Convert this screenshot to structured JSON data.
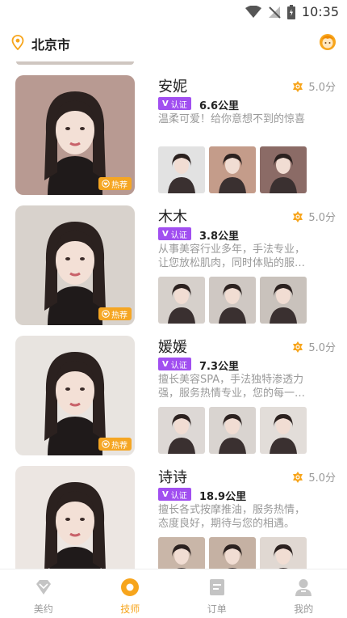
{
  "status_bar": {
    "time": "10:35"
  },
  "header": {
    "city": "北京市"
  },
  "technicians": [
    {
      "name": "安妮",
      "rating": "5.0分",
      "badge": "认证",
      "distance": "6.6公里",
      "description": "温柔可爱！给你意想不到的惊喜",
      "tag": "热荐",
      "photo_bg": "#b89a92",
      "thumb_bgs": [
        "#e2e2e2",
        "#c49c8a",
        "#8b6b66"
      ]
    },
    {
      "name": "木木",
      "rating": "5.0分",
      "badge": "认证",
      "distance": "3.8公里",
      "description": "从事美容行业多年，手法专业，让您放松肌肉，同时体贴的服…",
      "tag": "热荐",
      "photo_bg": "#d8d2cc",
      "thumb_bgs": [
        "#d6d0cb",
        "#cfc8c3",
        "#c9c2bc"
      ]
    },
    {
      "name": "媛媛",
      "rating": "5.0分",
      "badge": "认证",
      "distance": "7.3公里",
      "description": "擅长美容SPA，手法独特渗透力强，服务热情专业，您的每一…",
      "tag": "热荐",
      "photo_bg": "#e8e4e0",
      "thumb_bgs": [
        "#ddd8d5",
        "#d9d4d0",
        "#e2ddd9"
      ]
    },
    {
      "name": "诗诗",
      "rating": "5.0分",
      "badge": "认证",
      "distance": "18.9公里",
      "description": "擅长各式按摩推油，服务热情，态度良好，期待与您的相遇。",
      "tag": "",
      "photo_bg": "#ece6e2",
      "thumb_bgs": [
        "#c9b6a8",
        "#c5b1a3",
        "#e0d8d2"
      ]
    }
  ],
  "tabs": [
    {
      "label": "美约",
      "icon": "diamond-icon",
      "active": false
    },
    {
      "label": "技师",
      "icon": "circle-target-icon",
      "active": true
    },
    {
      "label": "订单",
      "icon": "order-doc-icon",
      "active": false
    },
    {
      "label": "我的",
      "icon": "user-icon",
      "active": false
    }
  ],
  "colors": {
    "accent": "#f7a51c",
    "badge": "#a14ff0",
    "muted": "#999999"
  }
}
